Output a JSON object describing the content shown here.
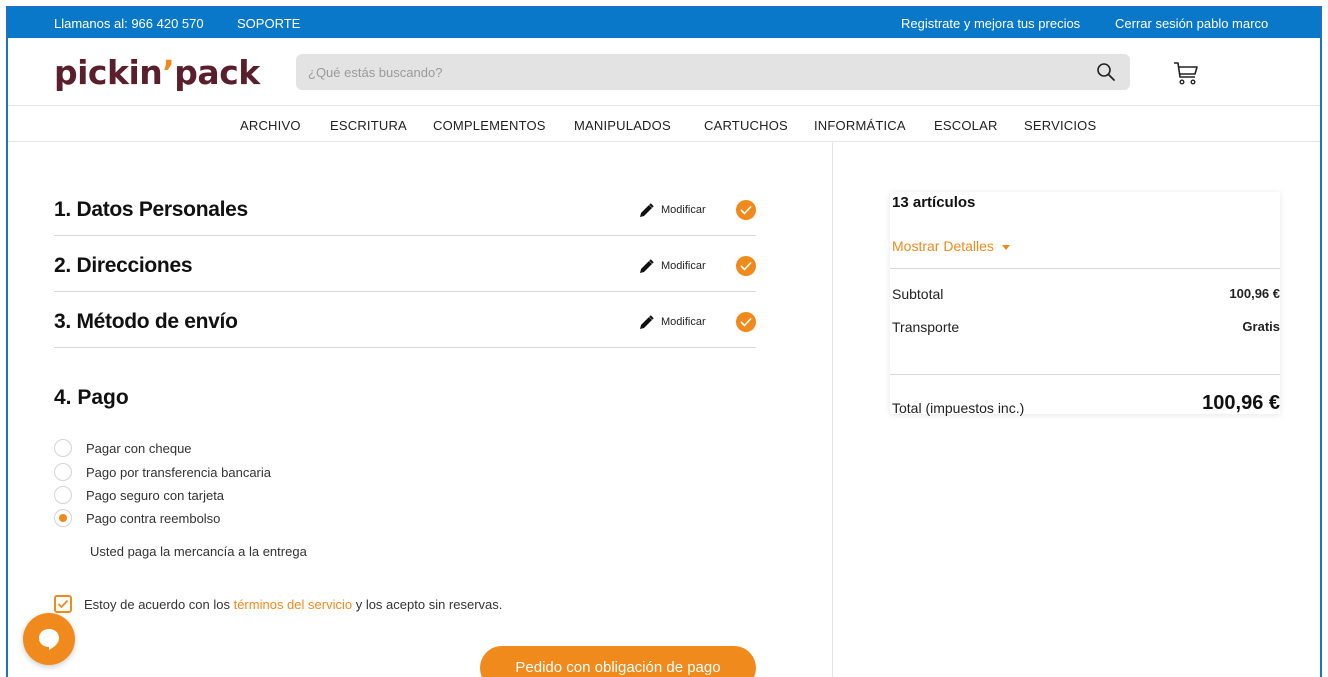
{
  "topbar": {
    "phone": "Llamanos al: 966 420 570",
    "support": "SOPORTE",
    "register": "Registrate y mejora tus precios",
    "logout": "Cerrar sesión pablo marco"
  },
  "header": {
    "logo_main": "pickin",
    "logo_apos": "’",
    "logo_end": "pack",
    "search_placeholder": "¿Qué estás buscando?"
  },
  "nav": {
    "items": [
      "ARCHIVO",
      "ESCRITURA",
      "COMPLEMENTOS",
      "MANIPULADOS",
      "CARTUCHOS",
      "INFORMÁTICA",
      "ESCOLAR",
      "SERVICIOS"
    ]
  },
  "checkout": {
    "steps": [
      {
        "title": "1. Datos Personales",
        "modify": "Modificar"
      },
      {
        "title": "2. Direcciones",
        "modify": "Modificar"
      },
      {
        "title": "3. Método de envío",
        "modify": "Modificar"
      }
    ],
    "payment": {
      "title": "4. Pago",
      "options": [
        "Pagar con cheque",
        "Pago por transferencia bancaria",
        "Pago seguro con tarjeta",
        "Pago contra reembolso"
      ],
      "selected_index": 3,
      "note": "Usted paga la mercancía a la entrega"
    },
    "terms": {
      "prefix": "Estoy de acuerdo con los ",
      "link": "términos del servicio",
      "suffix": " y los acepto sin reservas."
    },
    "order_button": "Pedido con obligación de pago"
  },
  "summary": {
    "count": "13 artículos",
    "details_link": "Mostrar Detalles",
    "subtotal_label": "Subtotal",
    "subtotal_value": "100,96 €",
    "shipping_label": "Transporte",
    "shipping_value": "Gratis",
    "total_label": "Total (impuestos inc.)",
    "total_value": "100,96 €"
  },
  "colors": {
    "topbar": "#0a78c8",
    "accent": "#f08a1c",
    "logo": "#5a1f2d"
  }
}
